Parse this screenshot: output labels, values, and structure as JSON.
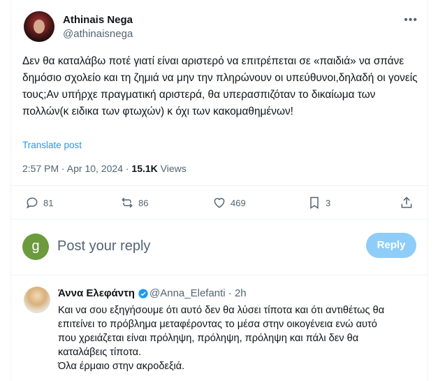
{
  "tweet": {
    "author_name": "Athinais Nega",
    "author_handle": "@athinaisnega",
    "more_icon": "•••",
    "text": "Δεν θα καταλάβω ποτέ γιατί είναι αριστερό να επιτρέπεται σε «παιδιά» να σπάνε δημόσιο σχολείο και τη ζημιά να μην την πληρώνουν οι υπεύθυνοι,δηλαδή οι γονείς τους;Αν υπήρχε πραγματική αριστερά, θα υπερασπιζόταν το δικαίωμα των πολλών(κ ειδικα των φτωχών) κ όχι των κακομαθημένων!",
    "translate_label": "Translate post",
    "time": "2:57 PM · Apr 10, 2024 · ",
    "views_count": "15.1K",
    "views_label": " Views",
    "actions": {
      "replies": "81",
      "reposts": "86",
      "likes": "469",
      "bookmarks": "3"
    }
  },
  "composer": {
    "avatar_letter": "g",
    "placeholder": "Post your reply",
    "reply_button": "Reply"
  },
  "reply": {
    "author_name": "Άννα Ελεφάντη",
    "author_handle": "@Anna_Elefanti · 2h",
    "text_lines": [
      "Και να σου εξηγήσουμε ότι αυτό δεν θα λύσει τίποτα και ότι αντιθέτως θα",
      "επιτείνει το πρόβλημα μεταφέροντας το μέσα στην οικογένεια ενώ αυτό",
      "που χρειάζεται είναι πρόληψη, πρόληψη, πρόληψη και πάλι δεν θα",
      "καταλάβεις τίποτα.",
      "Όλα έρμαιο στην ακροδεξιά."
    ]
  },
  "colors": {
    "accent": "#1d9bf0",
    "secondary_text": "#536471",
    "reply_button_bg": "#8ecdf8",
    "divider": "#eff3f4"
  }
}
